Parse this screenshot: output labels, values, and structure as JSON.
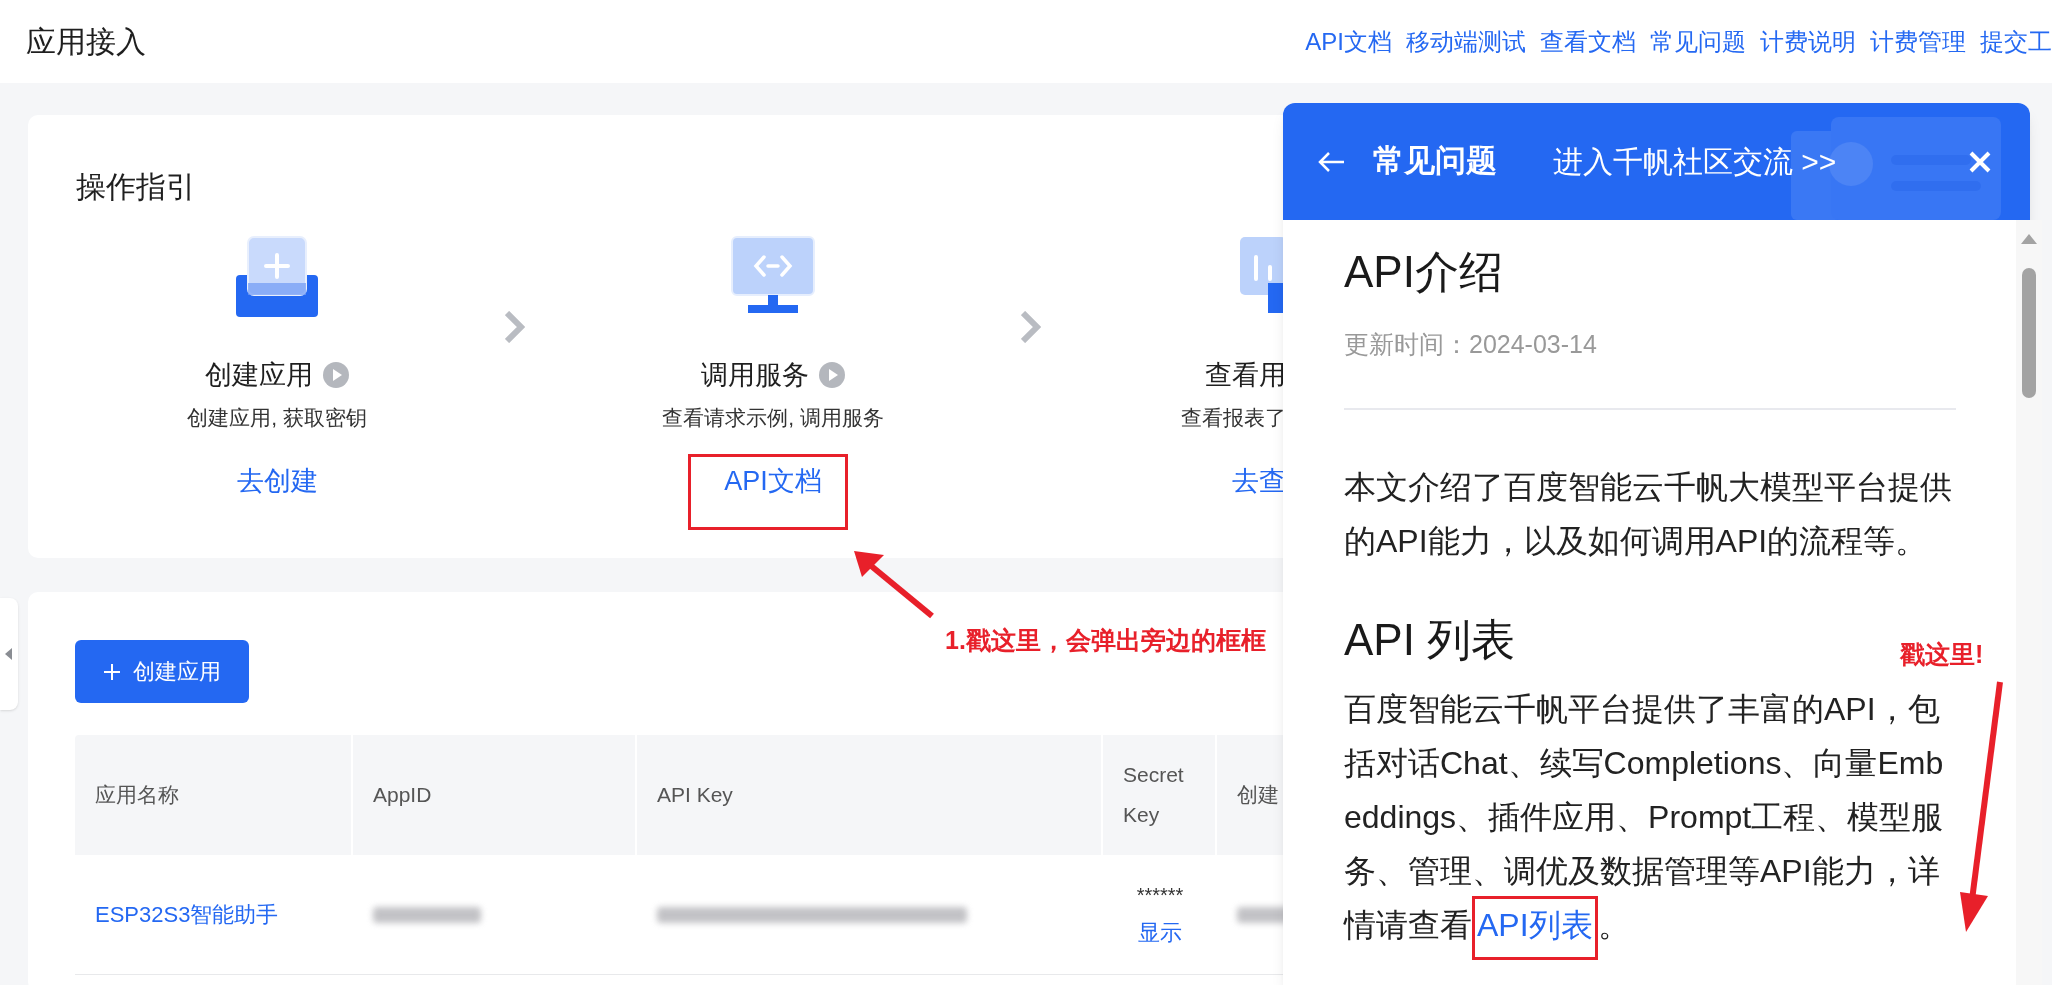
{
  "header": {
    "title": "应用接入",
    "links": [
      "API文档",
      "移动端测试",
      "查看文档",
      "常见问题",
      "计费说明",
      "计费管理",
      "提交工"
    ]
  },
  "guide": {
    "title": "操作指引",
    "steps": [
      {
        "kind": "create",
        "title": "创建应用",
        "has_video": true,
        "subtitle": "创建应用, 获取密钥",
        "link": "去创建"
      },
      {
        "kind": "code",
        "title": "调用服务",
        "has_video": true,
        "subtitle": "查看请求示例, 调用服务",
        "link": "API文档"
      },
      {
        "kind": "chart",
        "title": "查看用",
        "has_video": false,
        "subtitle": "查看报表了",
        "link": "去查"
      }
    ]
  },
  "apps": {
    "create_button": "创建应用",
    "columns": [
      "应用名称",
      "AppID",
      "API Key",
      "Secret Key",
      "创建"
    ],
    "rows": [
      {
        "name": "ESP32S3智能助手",
        "secret": "******",
        "show_link": "显示"
      }
    ]
  },
  "panel": {
    "title": "常见问题",
    "community_link": "进入千帆社区交流 >>",
    "doc": {
      "title": "API介绍",
      "updated": "更新时间：2024-03-14",
      "intro": "本文介绍了百度智能云千帆大模型平台提供的API能力，以及如何调用API的流程等。",
      "section_title": "API 列表",
      "section_text": "百度智能云千帆平台提供了丰富的API，包括对话Chat、续写Completions、向量Embeddings、插件应用、Prompt工程、模型服务、管理、调优及数据管理等API能力，详情请查看",
      "section_link": "API列表",
      "section_end": "。"
    }
  },
  "annotations": [
    "1.戳这里，会弹出旁边的框框",
    "戳这里!"
  ]
}
